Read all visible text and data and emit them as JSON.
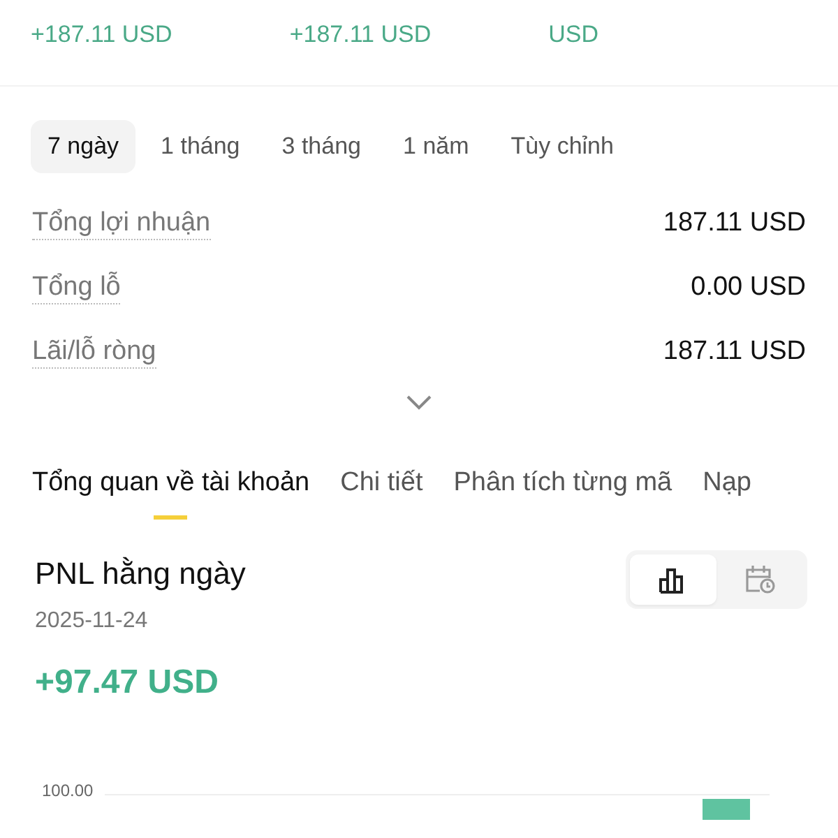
{
  "summary": [
    {
      "change": "+187.11 USD"
    },
    {
      "change": "+187.11 USD"
    },
    {
      "change": "USD"
    }
  ],
  "periods": [
    {
      "label": "7 ngày",
      "selected": true
    },
    {
      "label": "1 tháng",
      "selected": false
    },
    {
      "label": "3 tháng",
      "selected": false
    },
    {
      "label": "1 năm",
      "selected": false
    },
    {
      "label": "Tùy chỉnh",
      "selected": false
    }
  ],
  "stats": [
    {
      "label": "Tổng lợi nhuận",
      "value": "187.11 USD"
    },
    {
      "label": "Tổng lỗ",
      "value": "0.00 USD"
    },
    {
      "label": "Lãi/lỗ ròng",
      "value": "187.11 USD"
    }
  ],
  "tabs": [
    {
      "label": "Tổng quan về tài khoản",
      "selected": true
    },
    {
      "label": "Chi tiết",
      "selected": false
    },
    {
      "label": "Phân tích từng mã",
      "selected": false
    },
    {
      "label": "Nạp",
      "selected": false
    }
  ],
  "daily_pnl": {
    "title": "PNL hằng ngày",
    "date": "2025-11-24",
    "amount": "+97.47 USD",
    "views": [
      {
        "kind": "bar",
        "selected": true
      },
      {
        "kind": "calendar",
        "selected": false
      }
    ],
    "axis_label": "100.00"
  }
}
